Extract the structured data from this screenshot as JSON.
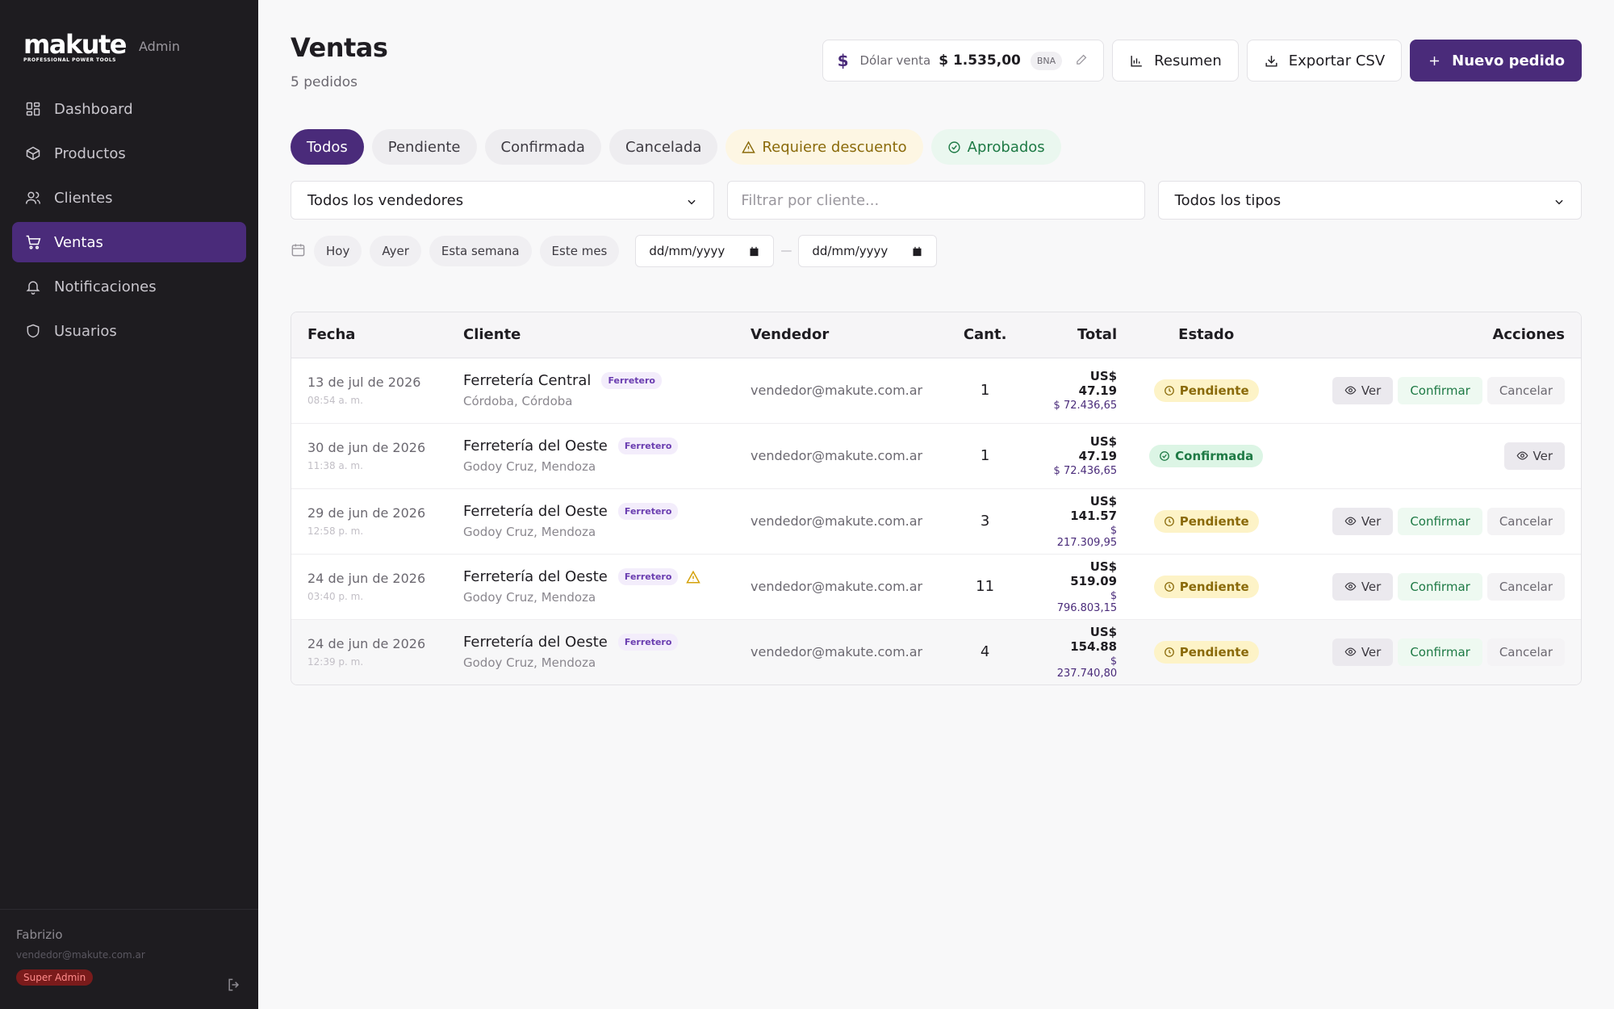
{
  "brand": {
    "logo": "makute",
    "tagline": "PROFESSIONAL POWER TOOLS",
    "section": "Admin"
  },
  "nav": [
    {
      "label": "Dashboard",
      "icon": "dashboard-icon"
    },
    {
      "label": "Productos",
      "icon": "box-icon"
    },
    {
      "label": "Clientes",
      "icon": "users-icon"
    },
    {
      "label": "Ventas",
      "icon": "cart-icon",
      "active": true
    },
    {
      "label": "Notificaciones",
      "icon": "bell-icon"
    },
    {
      "label": "Usuarios",
      "icon": "shield-icon"
    }
  ],
  "user": {
    "name": "Fabrizio",
    "email": "vendedor@makute.com.ar",
    "role": "Super Admin"
  },
  "header": {
    "title": "Ventas",
    "subtitle": "5 pedidos"
  },
  "dollar": {
    "label": "Dólar venta",
    "value": "$ 1.535,00",
    "source": "BNA"
  },
  "buttons": {
    "summary": "Resumen",
    "export": "Exportar CSV",
    "new_order": "Nuevo pedido"
  },
  "status_tabs": [
    "Todos",
    "Pendiente",
    "Confirmada",
    "Cancelada",
    "Requiere descuento",
    "Aprobados"
  ],
  "filters": {
    "seller": "Todos los vendedores",
    "client_placeholder": "Filtrar por cliente...",
    "type": "Todos los tipos"
  },
  "date_filters": {
    "chips": [
      "Hoy",
      "Ayer",
      "Esta semana",
      "Este mes"
    ],
    "from_placeholder": "dd/mm/yyyy",
    "separator": "—",
    "to_placeholder": "dd/mm/yyyy"
  },
  "table": {
    "headers": [
      "Fecha",
      "Cliente",
      "Vendedor",
      "Cant.",
      "Total",
      "Estado",
      "Acciones"
    ],
    "actions": {
      "view": "Ver",
      "confirm": "Confirmar",
      "cancel": "Cancelar"
    },
    "rows": [
      {
        "date": "13 de jul de 2026",
        "time": "08:54 a. m.",
        "client": "Ferretería Central",
        "tag": "Ferretero",
        "location": "Córdoba, Córdoba",
        "seller": "vendedor@makute.com.ar",
        "qty": "1",
        "usd": "US$ 47.19",
        "ars": "$ 72.436,65",
        "status": "Pendiente"
      },
      {
        "date": "30 de jun de 2026",
        "time": "11:38 a. m.",
        "client": "Ferretería del Oeste",
        "tag": "Ferretero",
        "location": "Godoy Cruz, Mendoza",
        "seller": "vendedor@makute.com.ar",
        "qty": "1",
        "usd": "US$ 47.19",
        "ars": "$ 72.436,65",
        "status": "Confirmada"
      },
      {
        "date": "29 de jun de 2026",
        "time": "12:58 p. m.",
        "client": "Ferretería del Oeste",
        "tag": "Ferretero",
        "location": "Godoy Cruz, Mendoza",
        "seller": "vendedor@makute.com.ar",
        "qty": "3",
        "usd": "US$ 141.57",
        "ars": "$ 217.309,95",
        "status": "Pendiente"
      },
      {
        "date": "24 de jun de 2026",
        "time": "03:40 p. m.",
        "client": "Ferretería del Oeste",
        "tag": "Ferretero",
        "location": "Godoy Cruz, Mendoza",
        "seller": "vendedor@makute.com.ar",
        "qty": "11",
        "usd": "US$ 519.09",
        "ars": "$ 796.803,15",
        "status": "Pendiente",
        "warning": true
      },
      {
        "date": "24 de jun de 2026",
        "time": "12:39 p. m.",
        "client": "Ferretería del Oeste",
        "tag": "Ferretero",
        "location": "Godoy Cruz, Mendoza",
        "seller": "vendedor@makute.com.ar",
        "qty": "4",
        "usd": "US$ 154.88",
        "ars": "$ 237.740,80",
        "status": "Pendiente"
      }
    ]
  }
}
